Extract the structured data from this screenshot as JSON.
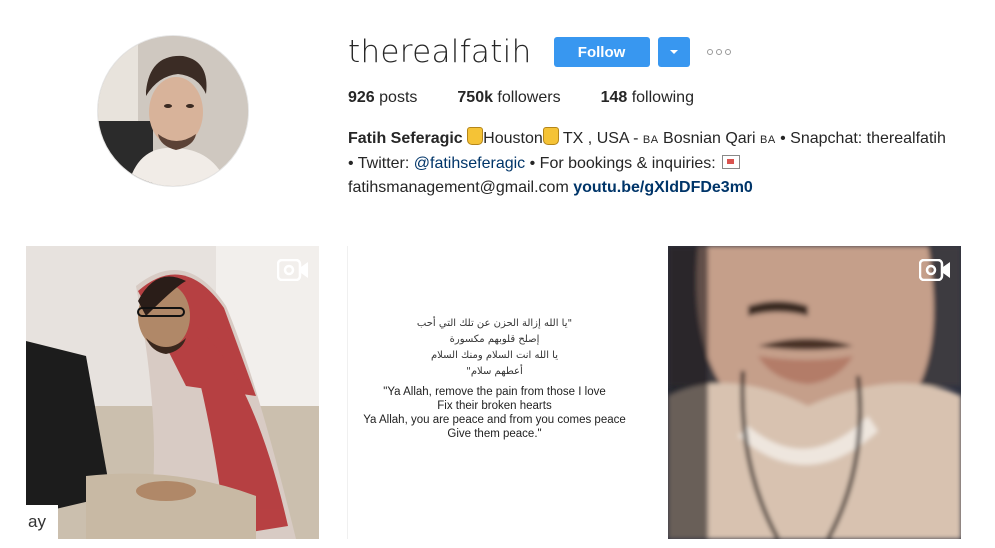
{
  "profile": {
    "username": "therealfatih",
    "follow_label": "Follow",
    "stats": {
      "posts_count": "926",
      "posts_label": " posts",
      "followers_count": "750k",
      "followers_label": " followers",
      "following_count": "148",
      "following_label": " following"
    },
    "bio": {
      "full_name": "Fatih Seferagic",
      "line1_a": "Houston",
      "line1_b": " TX , USA - ",
      "flag1": "BA",
      "line1_c": " Bosnian Qari ",
      "flag2": "BA",
      "line1_d": " • Snapchat: therealfatih",
      "twitter_prefix": "• Twitter: ",
      "twitter_handle": "@fatihseferagic",
      "bookings": " • For bookings & inquiries: ",
      "email": "fatihsmanagement@gmail.com",
      "website": "youtu.be/gXldDFDe3m0"
    },
    "icons": {
      "avatar": "avatar-photo",
      "dropdown": "chevron-down-icon",
      "more": "ellipsis-icon",
      "video": "video-camera-icon",
      "hand": "hand-emoji-icon",
      "envelope": "envelope-emoji-icon"
    },
    "colors": {
      "accent": "#3897f0",
      "link": "#003569"
    }
  },
  "posts": [
    {
      "kind": "video",
      "overlay_text": "ay"
    },
    {
      "kind": "image",
      "arabic_lines": [
        "\"يا الله إزالة الحزن عن تلك التي أحب",
        "إصلح قلوبهم مكسورة",
        "يا الله انت السلام ومنك السلام",
        "أعطهم سلام\""
      ],
      "english_lines": [
        "\"Ya Allah, remove the pain from those I love",
        "Fix their broken hearts",
        "Ya Allah, you are peace and from you comes peace",
        "Give them peace.\""
      ]
    },
    {
      "kind": "video"
    }
  ]
}
